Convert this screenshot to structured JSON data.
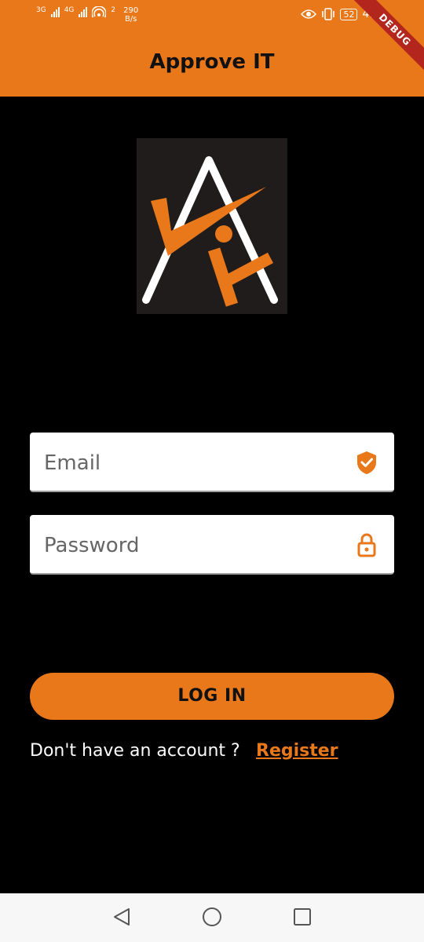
{
  "status_bar": {
    "network_1": "3G",
    "network_2": "4G",
    "hotspot": "2",
    "speed_value": "290",
    "speed_unit": "B/s",
    "battery": "52",
    "time": "4:2",
    "debug_label": "DEBUG"
  },
  "appbar": {
    "title": "Approve IT"
  },
  "form": {
    "email_placeholder": "Email",
    "password_placeholder": "Password",
    "login_label": "LOG IN",
    "no_account_text": "Don't have an account ?",
    "register_label": "Register"
  },
  "icons": {
    "email": "shield-check-icon",
    "password": "lock-icon",
    "nav_back": "triangle-back-icon",
    "nav_home": "circle-home-icon",
    "nav_recent": "square-recent-icon"
  },
  "colors": {
    "accent": "#E8781A",
    "background": "#000000",
    "logo_bg": "#1f1c1b"
  }
}
